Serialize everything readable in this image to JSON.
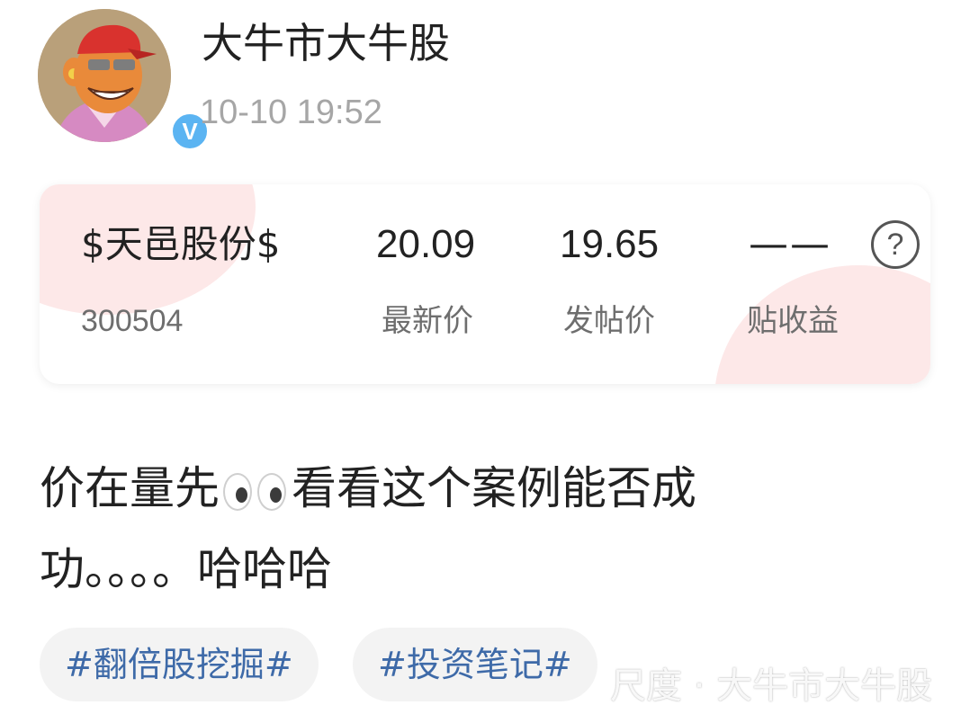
{
  "post": {
    "author": {
      "name": "大牛市大牛股",
      "verified_badge": "V",
      "avatar_icon": "cartoon-ape-avatar"
    },
    "timestamp": "10-10 19:52",
    "stock_card": {
      "name": "$天邑股份$",
      "code": "300504",
      "latest_price": "20.09",
      "latest_price_label": "最新价",
      "post_price": "19.65",
      "post_price_label": "发帖价",
      "post_return": "——",
      "post_return_label": "贴收益",
      "help_icon": "?"
    },
    "content": {
      "text_before_emoji": "价在量先",
      "emoji": "eyes-emoji",
      "text_after_emoji": "看看这个案例能否成功。。。。哈哈哈"
    },
    "tags": [
      "#翻倍股挖掘#",
      "#投资笔记#"
    ]
  },
  "watermark": "尺度 · 大牛市大牛股",
  "colors": {
    "tag_text": "#3e6aa8",
    "card_decoration": "#fde8e8",
    "verified_badge": "#5bb4f2",
    "secondary_text": "#a6a6a6"
  }
}
